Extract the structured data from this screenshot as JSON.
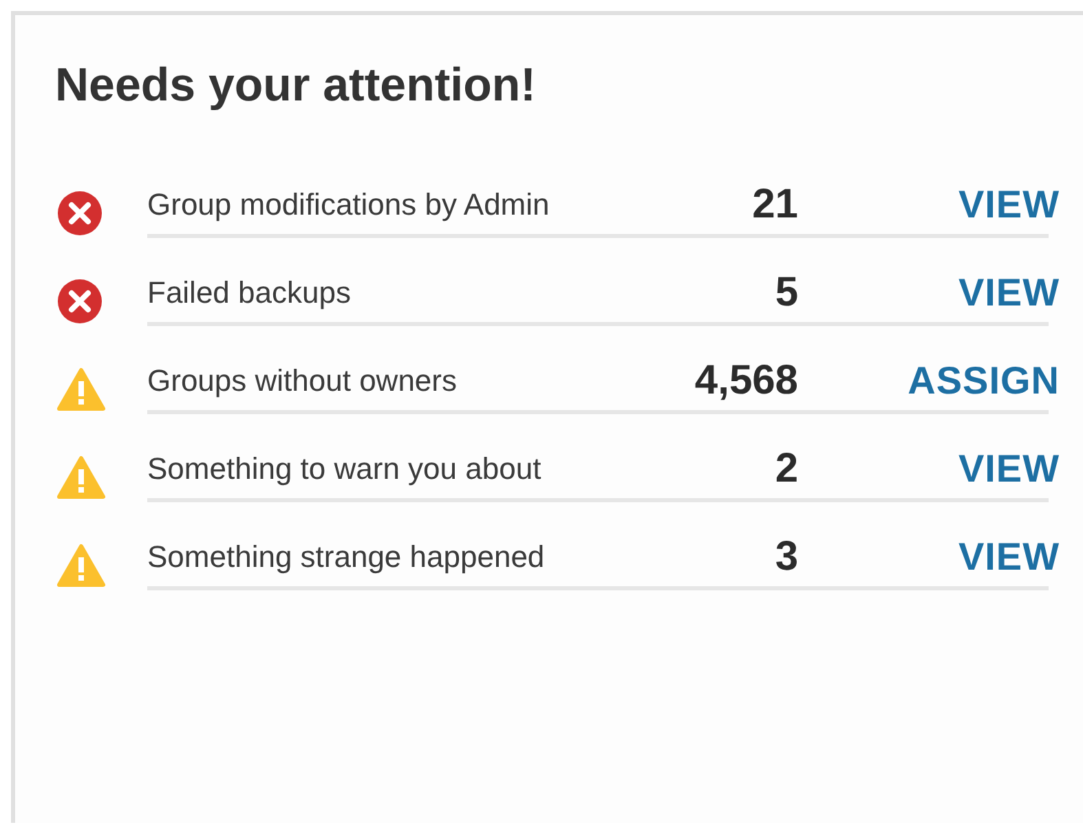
{
  "title": "Needs your attention!",
  "items": [
    {
      "kind": "error",
      "label": "Group modifications by Admin",
      "count": "21",
      "action": "VIEW"
    },
    {
      "kind": "error",
      "label": "Failed backups",
      "count": "5",
      "action": "VIEW"
    },
    {
      "kind": "warning",
      "label": "Groups without owners",
      "count": "4,568",
      "action": "ASSIGN"
    },
    {
      "kind": "warning",
      "label": "Something to warn you about",
      "count": "2",
      "action": "VIEW"
    },
    {
      "kind": "warning",
      "label": "Something strange happened",
      "count": "3",
      "action": "VIEW"
    }
  ]
}
